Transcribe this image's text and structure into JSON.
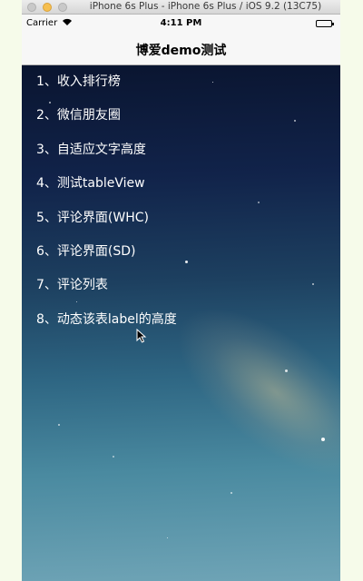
{
  "window": {
    "title": "iPhone 6s Plus - iPhone 6s Plus / iOS 9.2 (13C75)"
  },
  "status_bar": {
    "carrier": "Carrier",
    "time": "4:11 PM",
    "wifi_icon": "wifi-icon",
    "battery_icon": "battery-icon"
  },
  "nav": {
    "title": "博爱demo测试"
  },
  "list": {
    "items": [
      {
        "label": "1、收入排行榜"
      },
      {
        "label": "2、微信朋友圈"
      },
      {
        "label": "3、自适应文字高度"
      },
      {
        "label": "4、测试tableView"
      },
      {
        "label": "5、评论界面(WHC)"
      },
      {
        "label": "6、评论界面(SD)"
      },
      {
        "label": "7、评论列表"
      },
      {
        "label": "8、动态该表label的高度"
      }
    ]
  },
  "colors": {
    "page_background": "#f6fbea",
    "nav_background": "#f7f7f7",
    "list_text": "#ffffff"
  }
}
